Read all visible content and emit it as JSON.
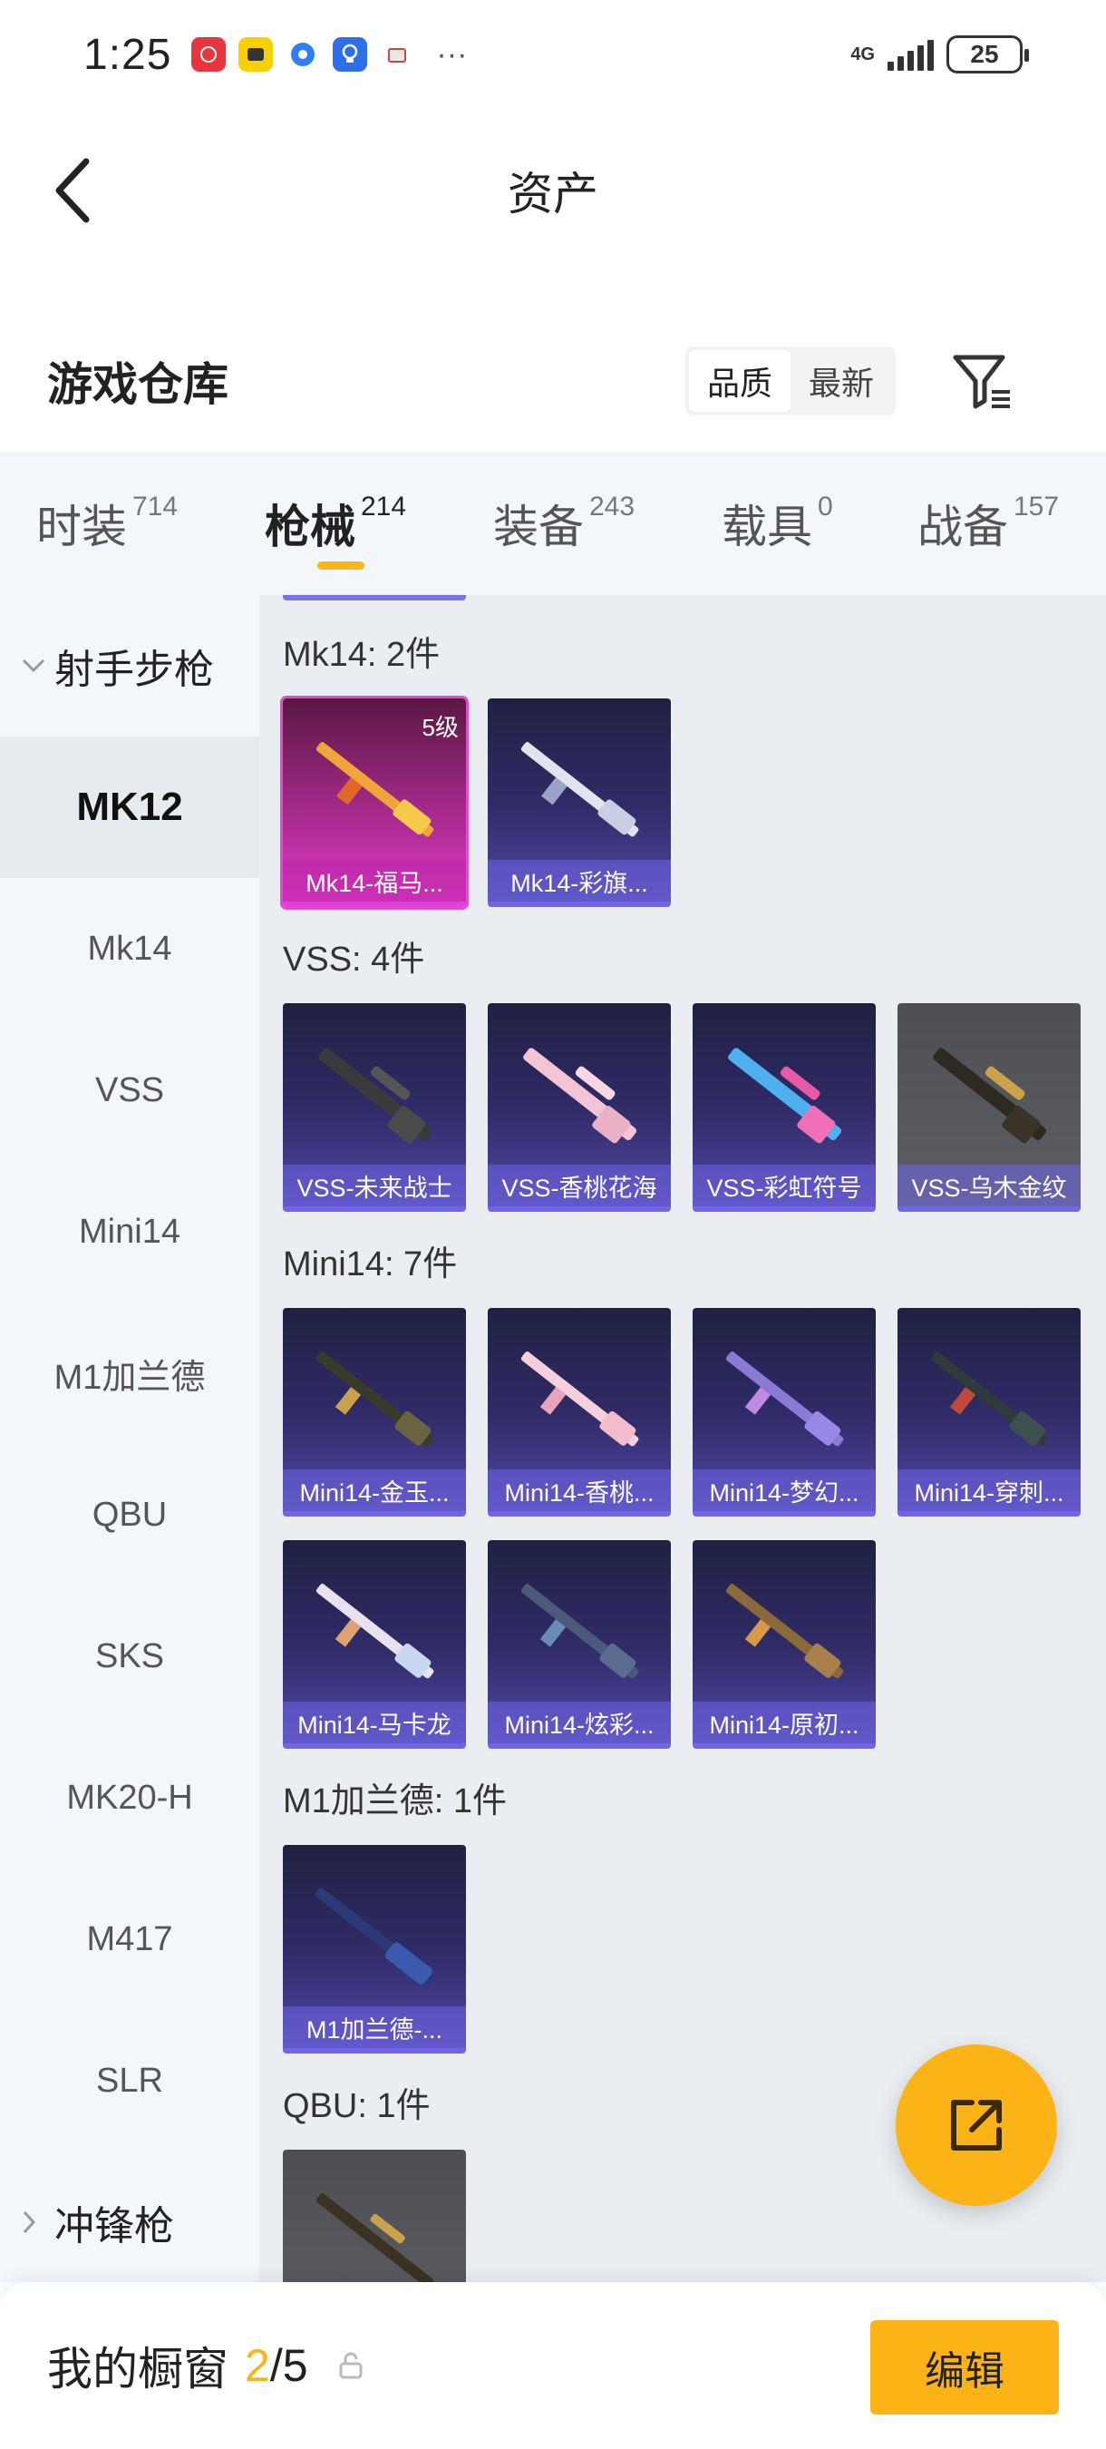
{
  "status_bar": {
    "time": "1:25",
    "network": "4G",
    "battery": "25",
    "notification_icons": [
      "huawei-app-icon",
      "game-app-icon",
      "browser-app-icon",
      "bulb-app-icon",
      "box-app-icon"
    ],
    "more": "···"
  },
  "nav": {
    "title": "资产"
  },
  "section": {
    "title": "游戏仓库",
    "sort_options": [
      "品质",
      "最新"
    ],
    "active_sort": "品质"
  },
  "tabs": [
    {
      "label": "时装",
      "count": "714"
    },
    {
      "label": "枪械",
      "count": "214"
    },
    {
      "label": "装备",
      "count": "243"
    },
    {
      "label": "载具",
      "count": "0"
    },
    {
      "label": "战备",
      "count": "157"
    }
  ],
  "active_tab": "枪械",
  "sidebar": {
    "group_expanded": "射手步枪",
    "items": [
      "MK12",
      "Mk14",
      "VSS",
      "Mini14",
      "M1加兰德",
      "QBU",
      "SKS",
      "MK20-H",
      "M417",
      "SLR"
    ],
    "active_item": "MK12",
    "group_collapsed": "冲锋枪"
  },
  "groups": [
    {
      "title": "Mk14: 2件",
      "items": [
        {
          "label": "Mk14-福马...",
          "level": "5级"
        },
        {
          "label": "Mk14-彩旗..."
        }
      ]
    },
    {
      "title": "VSS: 4件",
      "items": [
        {
          "label": "VSS-未来战士"
        },
        {
          "label": "VSS-香桃花海"
        },
        {
          "label": "VSS-彩虹符号"
        },
        {
          "label": "VSS-乌木金纹"
        }
      ]
    },
    {
      "title": "Mini14: 7件",
      "items": [
        {
          "label": "Mini14-金玉..."
        },
        {
          "label": "Mini14-香桃..."
        },
        {
          "label": "Mini14-梦幻..."
        },
        {
          "label": "Mini14-穿刺..."
        },
        {
          "label": "Mini14-马卡龙"
        },
        {
          "label": "Mini14-炫彩..."
        },
        {
          "label": "Mini14-原初..."
        }
      ]
    },
    {
      "title": "M1加兰德: 1件",
      "items": [
        {
          "label": "M1加兰德-..."
        }
      ]
    },
    {
      "title": "QBU: 1件",
      "items": [
        {
          "label": ""
        }
      ]
    }
  ],
  "bottom_bar": {
    "title": "我的橱窗",
    "current": "2",
    "separator": "/",
    "total": "5",
    "edit_label": "编辑"
  },
  "colors": {
    "accent": "#fbb316",
    "card_purple": "#544aa8",
    "card_pink": "#e13bc8",
    "card_gray": "#5d5f65",
    "sidebar_bg": "#f3f6fb",
    "content_bg": "#eaedf2"
  }
}
